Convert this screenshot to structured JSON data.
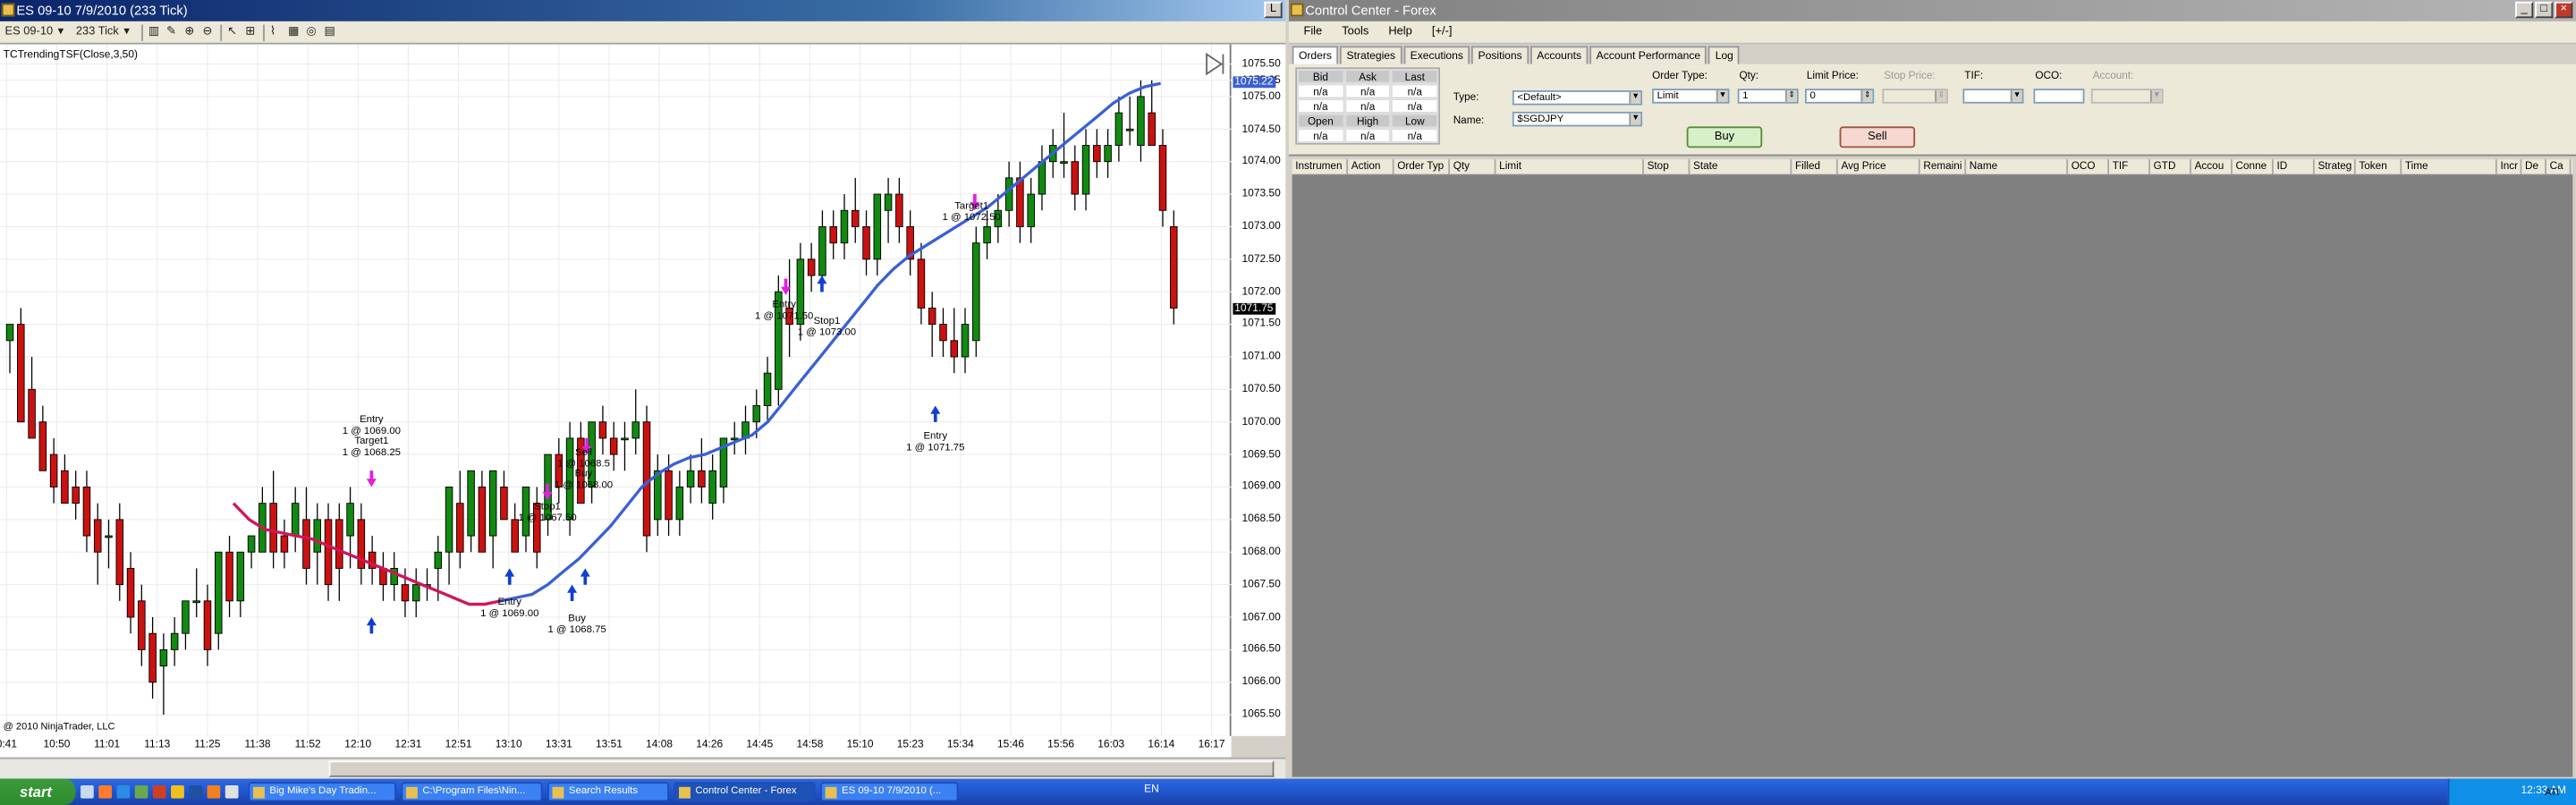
{
  "chart_window": {
    "title": "ES 09-10  7/9/2010 (233 Tick)",
    "toolbar": {
      "instrument": "ES 09-10",
      "interval": "233 Tick"
    },
    "indicator_label": "TCTrendingTSF(Close,3,50)",
    "copyright": "@ 2010 NinjaTrader, LLC",
    "price_labels": {
      "top": "1075.22",
      "last": "1071.75"
    }
  },
  "chart_data": {
    "type": "candlestick",
    "instrument": "ES 09-10",
    "interval": "233 Tick",
    "date": "7/9/2010",
    "ylim": [
      1065.25,
      1075.6
    ],
    "y_ticks": [
      "1075.50",
      "1075.25",
      "1075.00",
      "1074.50",
      "1074.00",
      "1073.50",
      "1073.00",
      "1072.50",
      "1072.00",
      "1071.50",
      "1071.00",
      "1070.50",
      "1070.00",
      "1069.50",
      "1069.00",
      "1068.50",
      "1068.00",
      "1067.50",
      "1067.00",
      "1066.50",
      "1066.00",
      "1065.50"
    ],
    "x_ticks": [
      "0:41",
      "10:50",
      "11:01",
      "11:13",
      "11:25",
      "11:38",
      "11:52",
      "12:10",
      "12:31",
      "12:51",
      "13:10",
      "13:31",
      "13:51",
      "14:08",
      "14:26",
      "14:45",
      "14:58",
      "15:10",
      "15:23",
      "15:34",
      "15:46",
      "15:56",
      "16:03",
      "16:14",
      "16:17"
    ],
    "candles": [
      [
        1071.25,
        1071.5,
        1070.75,
        1071.5
      ],
      [
        1071.5,
        1071.75,
        1070.0,
        1070.0
      ],
      [
        1070.5,
        1071.0,
        1069.75,
        1069.75
      ],
      [
        1070.0,
        1070.25,
        1069.25,
        1069.25
      ],
      [
        1069.5,
        1069.75,
        1068.75,
        1069.0
      ],
      [
        1069.25,
        1069.5,
        1068.75,
        1068.75
      ],
      [
        1069.0,
        1069.25,
        1068.5,
        1068.75
      ],
      [
        1069.0,
        1069.25,
        1068.0,
        1068.25
      ],
      [
        1068.5,
        1068.75,
        1067.5,
        1068.0
      ],
      [
        1068.25,
        1068.5,
        1067.75,
        1068.25
      ],
      [
        1068.5,
        1068.75,
        1067.25,
        1067.5
      ],
      [
        1067.75,
        1068.0,
        1066.75,
        1067.0
      ],
      [
        1067.25,
        1067.5,
        1066.25,
        1066.5
      ],
      [
        1066.75,
        1067.0,
        1065.75,
        1066.0
      ],
      [
        1066.25,
        1066.75,
        1065.5,
        1066.5
      ],
      [
        1066.5,
        1067.0,
        1066.25,
        1066.75
      ],
      [
        1066.75,
        1067.25,
        1066.5,
        1067.25
      ],
      [
        1067.25,
        1067.75,
        1067.0,
        1067.25
      ],
      [
        1067.25,
        1067.5,
        1066.25,
        1066.5
      ],
      [
        1066.75,
        1068.0,
        1066.5,
        1068.0
      ],
      [
        1068.0,
        1068.25,
        1067.0,
        1067.25
      ],
      [
        1067.25,
        1068.0,
        1067.0,
        1068.0
      ],
      [
        1068.0,
        1068.25,
        1067.75,
        1068.25
      ],
      [
        1068.0,
        1069.0,
        1068.0,
        1068.75
      ],
      [
        1068.75,
        1069.25,
        1067.75,
        1068.0
      ],
      [
        1068.25,
        1068.5,
        1067.75,
        1068.0
      ],
      [
        1068.25,
        1069.0,
        1068.0,
        1068.75
      ],
      [
        1068.5,
        1069.0,
        1067.5,
        1067.75
      ],
      [
        1068.0,
        1068.75,
        1067.5,
        1068.5
      ],
      [
        1068.5,
        1068.75,
        1067.25,
        1067.5
      ],
      [
        1068.5,
        1068.75,
        1067.25,
        1067.75
      ],
      [
        1068.25,
        1069.0,
        1067.75,
        1068.75
      ],
      [
        1068.5,
        1068.75,
        1067.5,
        1067.75
      ],
      [
        1068.0,
        1068.25,
        1067.5,
        1067.75
      ],
      [
        1067.75,
        1068.0,
        1067.25,
        1067.5
      ],
      [
        1067.5,
        1068.0,
        1067.25,
        1067.75
      ],
      [
        1067.5,
        1067.75,
        1067.0,
        1067.25
      ],
      [
        1067.25,
        1067.75,
        1067.0,
        1067.5
      ],
      [
        1067.5,
        1067.75,
        1067.25,
        1067.5
      ],
      [
        1067.75,
        1068.25,
        1067.25,
        1068.0
      ],
      [
        1068.0,
        1069.0,
        1067.5,
        1069.0
      ],
      [
        1068.75,
        1069.25,
        1067.75,
        1068.0
      ],
      [
        1068.25,
        1069.25,
        1068.0,
        1069.25
      ],
      [
        1069.0,
        1069.25,
        1068.0,
        1068.0
      ],
      [
        1068.25,
        1069.25,
        1067.75,
        1069.25
      ],
      [
        1069.0,
        1069.25,
        1068.5,
        1068.5
      ],
      [
        1068.5,
        1068.75,
        1068.0,
        1068.0
      ],
      [
        1068.25,
        1069.0,
        1068.0,
        1069.0
      ],
      [
        1068.75,
        1069.0,
        1067.75,
        1068.0
      ],
      [
        1068.5,
        1069.5,
        1068.25,
        1069.5
      ],
      [
        1069.5,
        1069.75,
        1068.75,
        1069.0
      ],
      [
        1068.5,
        1070.0,
        1068.25,
        1069.75
      ],
      [
        1069.75,
        1070.0,
        1068.75,
        1068.75
      ],
      [
        1069.0,
        1070.0,
        1068.75,
        1070.0
      ],
      [
        1070.0,
        1070.25,
        1069.5,
        1069.75
      ],
      [
        1069.75,
        1070.0,
        1069.25,
        1069.5
      ],
      [
        1069.75,
        1070.0,
        1069.25,
        1069.75
      ],
      [
        1069.75,
        1070.5,
        1069.5,
        1070.0
      ],
      [
        1070.0,
        1070.25,
        1068.0,
        1068.25
      ],
      [
        1068.5,
        1069.5,
        1068.25,
        1069.25
      ],
      [
        1069.25,
        1069.5,
        1068.25,
        1068.5
      ],
      [
        1068.5,
        1069.25,
        1068.25,
        1069.0
      ],
      [
        1069.0,
        1069.5,
        1068.75,
        1069.25
      ],
      [
        1069.25,
        1069.75,
        1068.75,
        1069.0
      ],
      [
        1068.75,
        1069.5,
        1068.5,
        1069.25
      ],
      [
        1069.0,
        1069.75,
        1068.75,
        1069.75
      ],
      [
        1069.75,
        1070.0,
        1069.5,
        1069.75
      ],
      [
        1069.75,
        1070.25,
        1069.5,
        1070.0
      ],
      [
        1070.0,
        1070.5,
        1069.75,
        1070.25
      ],
      [
        1070.25,
        1071.0,
        1070.0,
        1070.75
      ],
      [
        1070.5,
        1072.25,
        1070.25,
        1072.0
      ],
      [
        1071.75,
        1072.5,
        1071.0,
        1071.5
      ],
      [
        1071.5,
        1072.75,
        1071.25,
        1072.5
      ],
      [
        1072.5,
        1072.75,
        1072.0,
        1072.25
      ],
      [
        1072.25,
        1073.25,
        1072.0,
        1073.0
      ],
      [
        1073.0,
        1073.25,
        1072.5,
        1072.75
      ],
      [
        1072.75,
        1073.5,
        1072.5,
        1073.25
      ],
      [
        1073.25,
        1073.75,
        1072.75,
        1073.0
      ],
      [
        1073.0,
        1073.25,
        1072.25,
        1072.5
      ],
      [
        1072.5,
        1073.5,
        1072.25,
        1073.5
      ],
      [
        1073.25,
        1073.75,
        1072.75,
        1073.5
      ],
      [
        1073.5,
        1073.75,
        1072.75,
        1073.0
      ],
      [
        1073.0,
        1073.25,
        1072.25,
        1072.5
      ],
      [
        1072.5,
        1072.75,
        1071.5,
        1071.75
      ],
      [
        1071.75,
        1072.0,
        1071.0,
        1071.5
      ],
      [
        1071.5,
        1071.75,
        1071.0,
        1071.25
      ],
      [
        1071.25,
        1071.75,
        1070.75,
        1071.0
      ],
      [
        1071.0,
        1071.75,
        1070.75,
        1071.5
      ],
      [
        1071.25,
        1073.0,
        1071.0,
        1072.75
      ],
      [
        1072.75,
        1073.25,
        1072.5,
        1073.0
      ],
      [
        1073.0,
        1073.5,
        1072.75,
        1073.25
      ],
      [
        1073.25,
        1074.0,
        1073.0,
        1073.75
      ],
      [
        1073.75,
        1074.0,
        1072.75,
        1073.0
      ],
      [
        1073.0,
        1073.75,
        1072.75,
        1073.5
      ],
      [
        1073.5,
        1074.25,
        1073.25,
        1074.0
      ],
      [
        1074.0,
        1074.5,
        1073.75,
        1074.25
      ],
      [
        1074.0,
        1074.75,
        1073.75,
        1074.0
      ],
      [
        1074.0,
        1074.25,
        1073.25,
        1073.5
      ],
      [
        1073.5,
        1074.5,
        1073.25,
        1074.25
      ],
      [
        1074.25,
        1074.5,
        1073.75,
        1074.0
      ],
      [
        1074.0,
        1074.5,
        1073.75,
        1074.25
      ],
      [
        1074.25,
        1075.0,
        1074.0,
        1074.75
      ],
      [
        1074.5,
        1075.0,
        1074.25,
        1074.5
      ],
      [
        1074.25,
        1075.25,
        1074.0,
        1075.0
      ],
      [
        1074.75,
        1075.25,
        1074.25,
        1074.25
      ],
      [
        1074.25,
        1074.5,
        1073.0,
        1073.25
      ],
      [
        1073.0,
        1073.25,
        1071.5,
        1071.75
      ]
    ],
    "indicator": {
      "name": "TCTrendingTSF(Close,3,50)",
      "values": [
        1068.75,
        1068.5,
        1068.35,
        1068.3,
        1068.25,
        1068.2,
        1068.1,
        1068.0,
        1067.9,
        1067.8,
        1067.7,
        1067.6,
        1067.5,
        1067.4,
        1067.3,
        1067.2,
        1067.2,
        1067.25,
        1067.3,
        1067.35,
        1067.5,
        1067.7,
        1067.9,
        1068.15,
        1068.4,
        1068.7,
        1069.0,
        1069.2,
        1069.35,
        1069.45,
        1069.5,
        1069.6,
        1069.7,
        1069.8,
        1070.0,
        1070.3,
        1070.6,
        1070.9,
        1071.2,
        1071.5,
        1071.8,
        1072.1,
        1072.35,
        1072.55,
        1072.7,
        1072.85,
        1073.0,
        1073.15,
        1073.3,
        1073.5,
        1073.7,
        1073.9,
        1074.1,
        1074.3,
        1074.5,
        1074.7,
        1074.9,
        1075.05,
        1075.15,
        1075.2
      ]
    },
    "annotations": [
      {
        "text": "Entry\n1 @ 1069.00\nTarget1\n1 @ 1068.25"
      },
      {
        "text": "Entry\n1 @ 1069.00"
      },
      {
        "text": "Stop1\n1 @ 1067.50"
      },
      {
        "text": "Sell\n1 @ 1068.5\nBuy\n1 @ 1068.00"
      },
      {
        "text": "Buy\n1 @ 1068.75"
      },
      {
        "text": "Entry\n1 @ 1071.50"
      },
      {
        "text": "Stop1\n1 @ 1073.00"
      },
      {
        "text": "Target1\n1 @ 1072.50"
      },
      {
        "text": "Entry\n1 @ 1071.75"
      }
    ]
  },
  "control_center": {
    "title": "Control Center - Forex",
    "menu": [
      "File",
      "Tools",
      "Help",
      "[+/-]"
    ],
    "tabs": [
      "Orders",
      "Strategies",
      "Executions",
      "Positions",
      "Accounts",
      "Account Performance",
      "Log"
    ],
    "quote_headers1": [
      "Bid",
      "Ask",
      "Last"
    ],
    "quote_values1": [
      "n/a",
      "n/a",
      "n/a",
      "n/a",
      "n/a",
      "n/a"
    ],
    "quote_headers2": [
      "Open",
      "High",
      "Low"
    ],
    "quote_values2": [
      "n/a",
      "n/a",
      "n/a"
    ],
    "labels": {
      "type": "Type:",
      "name": "Name:",
      "order_type": "Order Type:",
      "qty": "Qty:",
      "limit_price": "Limit Price:",
      "stop_price": "Stop Price:",
      "tif": "TIF:",
      "oco": "OCO:",
      "account": "Account:"
    },
    "values": {
      "type": "<Default>",
      "name": "$SGDJPY",
      "order_type": "Limit",
      "qty": "1",
      "limit_price": "0"
    },
    "buy_label": "Buy",
    "sell_label": "Sell",
    "columns": [
      "Instrumen",
      "Action",
      "Order Typ",
      "Qty",
      "Limit",
      "Stop",
      "State",
      "Filled",
      "Avg Price",
      "Remaini",
      "Name",
      "OCO",
      "TIF",
      "GTD",
      "Accou",
      "Conne",
      "ID",
      "Strateg",
      "Token",
      "Time",
      "Incr",
      "De",
      "Ca"
    ]
  },
  "taskbar": {
    "start": "start",
    "tasks": [
      "Big Mike's Day Tradin...",
      "C:\\Program Files\\Nin...",
      "Search Results",
      "Control Center - Forex",
      "ES 09-10  7/9/2010 (..."
    ],
    "language": "EN",
    "clock": "12:33 AM",
    "status": "ATI"
  }
}
